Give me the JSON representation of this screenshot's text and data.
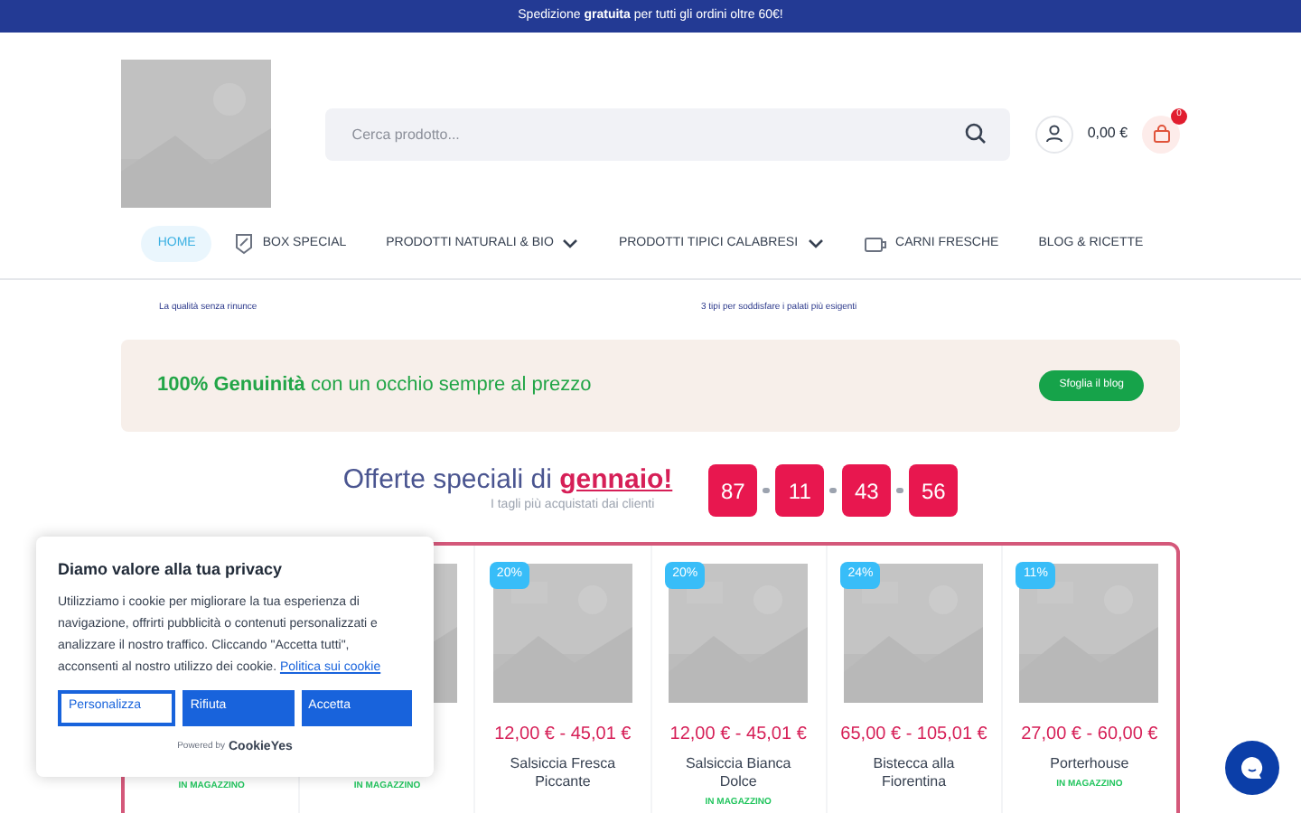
{
  "top_bar": {
    "text": "Spedizione **gratuita** per tutti gli ordini oltre 60€!"
  },
  "header": {
    "search": {
      "placeholder": "Cerca prodotto..."
    },
    "cart_total": "0,00 €",
    "cart_count": "0"
  },
  "nav": [
    {
      "label": "HOME",
      "selected": true,
      "kind": "plain",
      "caret": false
    },
    {
      "label": "BOX SPECIAL",
      "selected": false,
      "kind": "tag",
      "caret": false
    },
    {
      "label": "PRODOTTI NATURALI & BIO",
      "selected": false,
      "kind": "plain",
      "caret": true
    },
    {
      "label": "PRODOTTI TIPICI CALABRESI",
      "selected": false,
      "kind": "plain",
      "caret": true
    },
    {
      "label": "CARNI FRESCHE",
      "selected": false,
      "kind": "meat",
      "caret": false
    },
    {
      "label": "BLOG & RICETTE",
      "selected": false,
      "kind": "plain",
      "caret": false
    }
  ],
  "features": [
    "La qualità senza rinunce",
    "3 tipi per soddisfare i palati più esigenti"
  ],
  "promo": {
    "text": "**100% Genuinità** con un occhio sempre al prezzo",
    "button": "Sfoglia il blog"
  },
  "offers": {
    "title": "Offerte speciali di",
    "highlight": "gennaio!",
    "subtitle": "I tagli più acquistati dai clienti",
    "countdown": [
      "87",
      "11",
      "43",
      "56"
    ]
  },
  "products": [
    {
      "stock": "IN MAGAZZINO"
    },
    {
      "kind": "picture",
      "stock": "IN MAGAZZINO"
    },
    {
      "kind": "picture",
      "badge": "20%",
      "price": "12,00 € - 45,01 €",
      "name": "Salsiccia Fresca Piccante"
    },
    {
      "kind": "picture",
      "badge": "20%",
      "price": "12,00 € - 45,01 €",
      "name": "Salsiccia Bianca Dolce",
      "stock": "IN MAGAZZINO"
    },
    {
      "kind": "picture",
      "badge": "24%",
      "price": "65,00 € - 105,01 €",
      "name": "Bistecca alla Fiorentina"
    },
    {
      "kind": "picture",
      "badge": "11%",
      "price": "27,00 € - 60,00 €",
      "name": "Porterhouse",
      "stock": "IN MAGAZZINO"
    }
  ],
  "cookie_banner": {
    "title": "Diamo valore alla tua privacy",
    "text": "Utilizziamo i cookie per migliorare la tua esperienza di navigazione, offrirti pubblicità o contenuti personalizzati e analizzare il nostro traffico. Cliccando \"Accetta tutti\", acconsenti al nostro utilizzo dei cookie.",
    "link": "Politica sui cookie",
    "buttons": [
      {
        "label": "Personalizza",
        "kind": "outline"
      },
      {
        "label": "Rifiuta",
        "kind": "solid"
      },
      {
        "label": "Accetta",
        "kind": "solid"
      }
    ],
    "powered_by": "Powered by",
    "brand": "CookieYes"
  }
}
